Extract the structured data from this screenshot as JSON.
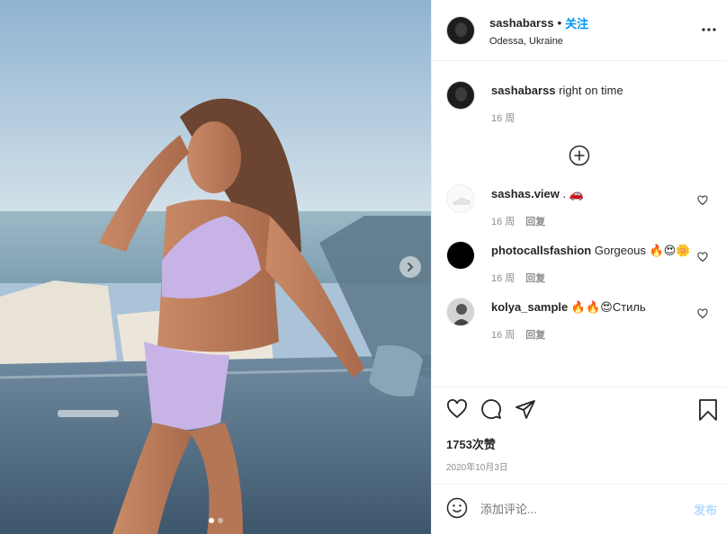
{
  "post": {
    "photo_description_icon": "photo",
    "page_index": 1,
    "page_count": 2
  },
  "header": {
    "username": "sashabarss",
    "separator": "•",
    "follow_label": "关注",
    "location": "Odessa, Ukraine",
    "more_label": "•••"
  },
  "caption": {
    "username": "sashabarss",
    "text": "right on time",
    "time": "16 周"
  },
  "comments": [
    {
      "username": "sashas.view",
      "text": ". 🚗",
      "time": "16 周",
      "reply": "回复"
    },
    {
      "username": "photocallsfashion",
      "text": "Gorgeous 🔥😍🌼",
      "time": "16 周",
      "reply": "回复"
    },
    {
      "username": "kolya_sample",
      "text": "🔥🔥😍Стиль",
      "time": "16 周",
      "reply": "回复"
    }
  ],
  "footer": {
    "likes": "1753次赞",
    "date": "2020年10月3日",
    "add_placeholder": "添加评论...",
    "post_label": "发布"
  },
  "colors": {
    "link_blue": "#0095f6",
    "post_disabled": "#b3dbff",
    "meta_gray": "#8e8e8e"
  }
}
